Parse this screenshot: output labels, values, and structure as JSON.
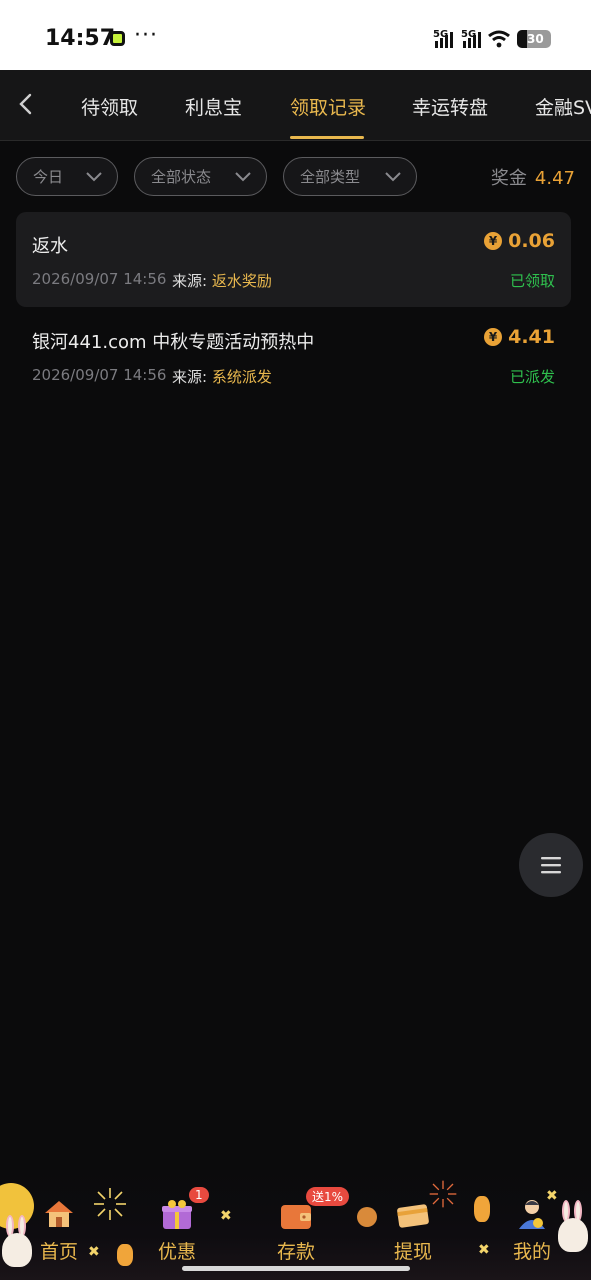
{
  "status_bar": {
    "time": "14:57",
    "dots": "···",
    "sig1": "5G",
    "sig2": "5G",
    "battery": "30"
  },
  "nav": {
    "tabs": [
      {
        "label": "待领取"
      },
      {
        "label": "利息宝"
      },
      {
        "label": "领取记录"
      },
      {
        "label": "幸运转盘"
      },
      {
        "label": "金融SV"
      }
    ],
    "active_index": 2
  },
  "filters": {
    "date": "今日",
    "status": "全部状态",
    "type": "全部类型",
    "bonus_label": "奖金",
    "bonus_amount": "4.47"
  },
  "records": [
    {
      "title": "返水",
      "amount": "0.06",
      "coin": "¥",
      "date": "2026/09/07 14:56",
      "source_label": "来源:",
      "source": "返水奖励",
      "status": "已领取"
    },
    {
      "title": "银河441.com 中秋专题活动预热中",
      "amount": "4.41",
      "coin": "¥",
      "date": "2026/09/07 14:56",
      "source_label": "来源:",
      "source": "系统派发",
      "status": "已派发"
    }
  ],
  "tabbar": {
    "items": [
      {
        "label": "首页",
        "icon": "house-icon"
      },
      {
        "label": "优惠",
        "icon": "gift-icon",
        "badge": "1"
      },
      {
        "label": "存款",
        "icon": "wallet-icon",
        "badge": "送1%"
      },
      {
        "label": "提现",
        "icon": "card-icon"
      },
      {
        "label": "我的",
        "icon": "user-icon"
      }
    ]
  },
  "colors": {
    "accent": "#e9b84e",
    "amount": "#e9a236",
    "success": "#2fc04e",
    "background": "#0b0b0c"
  }
}
